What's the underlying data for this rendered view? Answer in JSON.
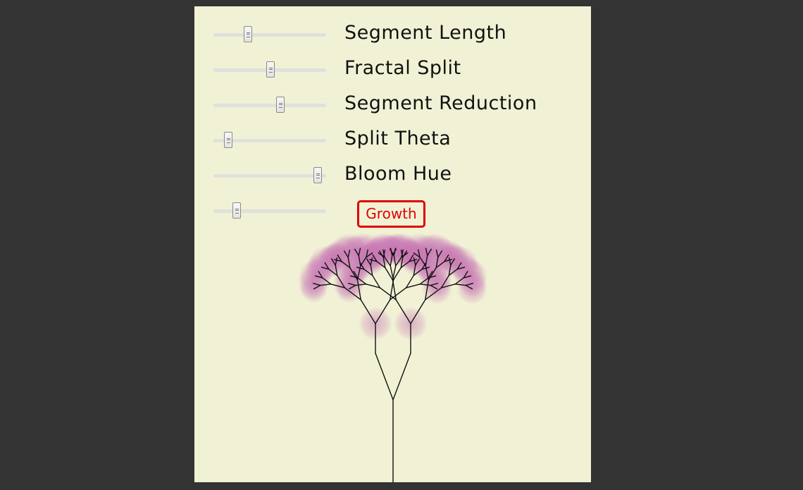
{
  "controls": {
    "sliders": [
      {
        "id": "segment-length",
        "label": "Segment Length",
        "value": 0.31
      },
      {
        "id": "fractal-split",
        "label": "Fractal Split",
        "value": 0.51
      },
      {
        "id": "segment-reduction",
        "label": "Segment Reduction",
        "value": 0.6
      },
      {
        "id": "split-theta",
        "label": "Split Theta",
        "value": 0.14
      },
      {
        "id": "bloom-hue",
        "label": "Bloom Hue",
        "value": 0.93
      }
    ],
    "growth": {
      "value": 0.21,
      "button_label": "Growth"
    }
  },
  "colors": {
    "background": "#333333",
    "panel": "#f1f2d5",
    "branch": "#111111",
    "bloom": "#c878b4",
    "growth_accent": "#e00000"
  },
  "icons": {
    "slider_thumb": "grip-lines-icon"
  }
}
